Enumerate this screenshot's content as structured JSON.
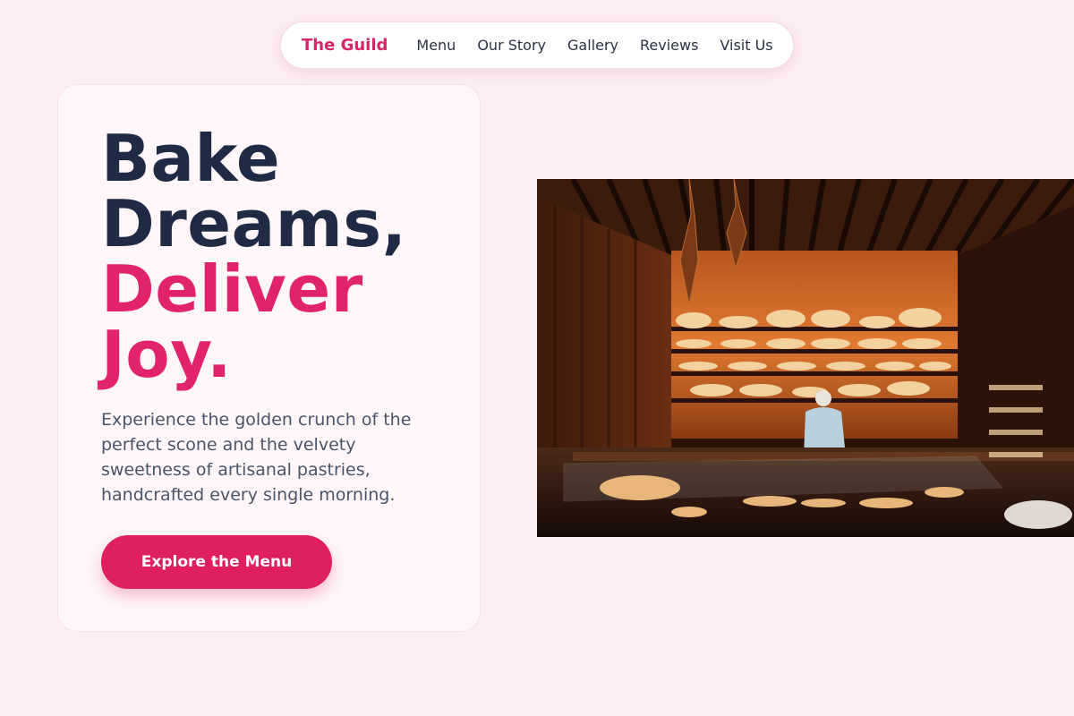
{
  "nav": {
    "brand": "The Guild",
    "links": [
      "Menu",
      "Our Story",
      "Gallery",
      "Reviews",
      "Visit Us"
    ]
  },
  "hero": {
    "line1": "Bake",
    "line2": "Dreams,",
    "line3": "Deliver",
    "line4": "Joy.",
    "description": "Experience the golden crunch of the perfect scone and the velvety sweetness of artisanal pastries, handcrafted every single morning.",
    "cta_label": "Explore the Menu"
  },
  "colors": {
    "background": "#fdeef3",
    "accent": "#e01f62",
    "heading": "#1f2a44",
    "body_text": "#4a5468"
  },
  "image": {
    "subject": "bakery interior photo"
  }
}
